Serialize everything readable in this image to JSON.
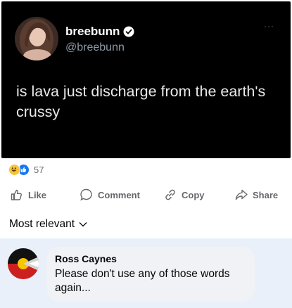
{
  "tweet": {
    "display_name": "breebunn",
    "handle": "@breebunn",
    "more": "···",
    "text": "is lava just discharge from the earth's crussy"
  },
  "reactions": {
    "count": "57"
  },
  "actions": {
    "like": "Like",
    "comment": "Comment",
    "copy": "Copy",
    "share": "Share"
  },
  "sort": {
    "label": "Most relevant"
  },
  "comment": {
    "author": "Ross Caynes",
    "text": "Please don't use any of those words again..."
  },
  "colors": {
    "tweet_bg": "#000000",
    "comment_highlight": "#e9f0fa",
    "bubble": "#f0f2f5",
    "like_blue": "#1877f2",
    "muted": "#65676b"
  },
  "icons": [
    "verified-icon",
    "haha-icon",
    "like-reaction-icon",
    "thumbs-up-icon",
    "comment-icon",
    "link-icon",
    "share-icon",
    "chevron-down-icon"
  ]
}
